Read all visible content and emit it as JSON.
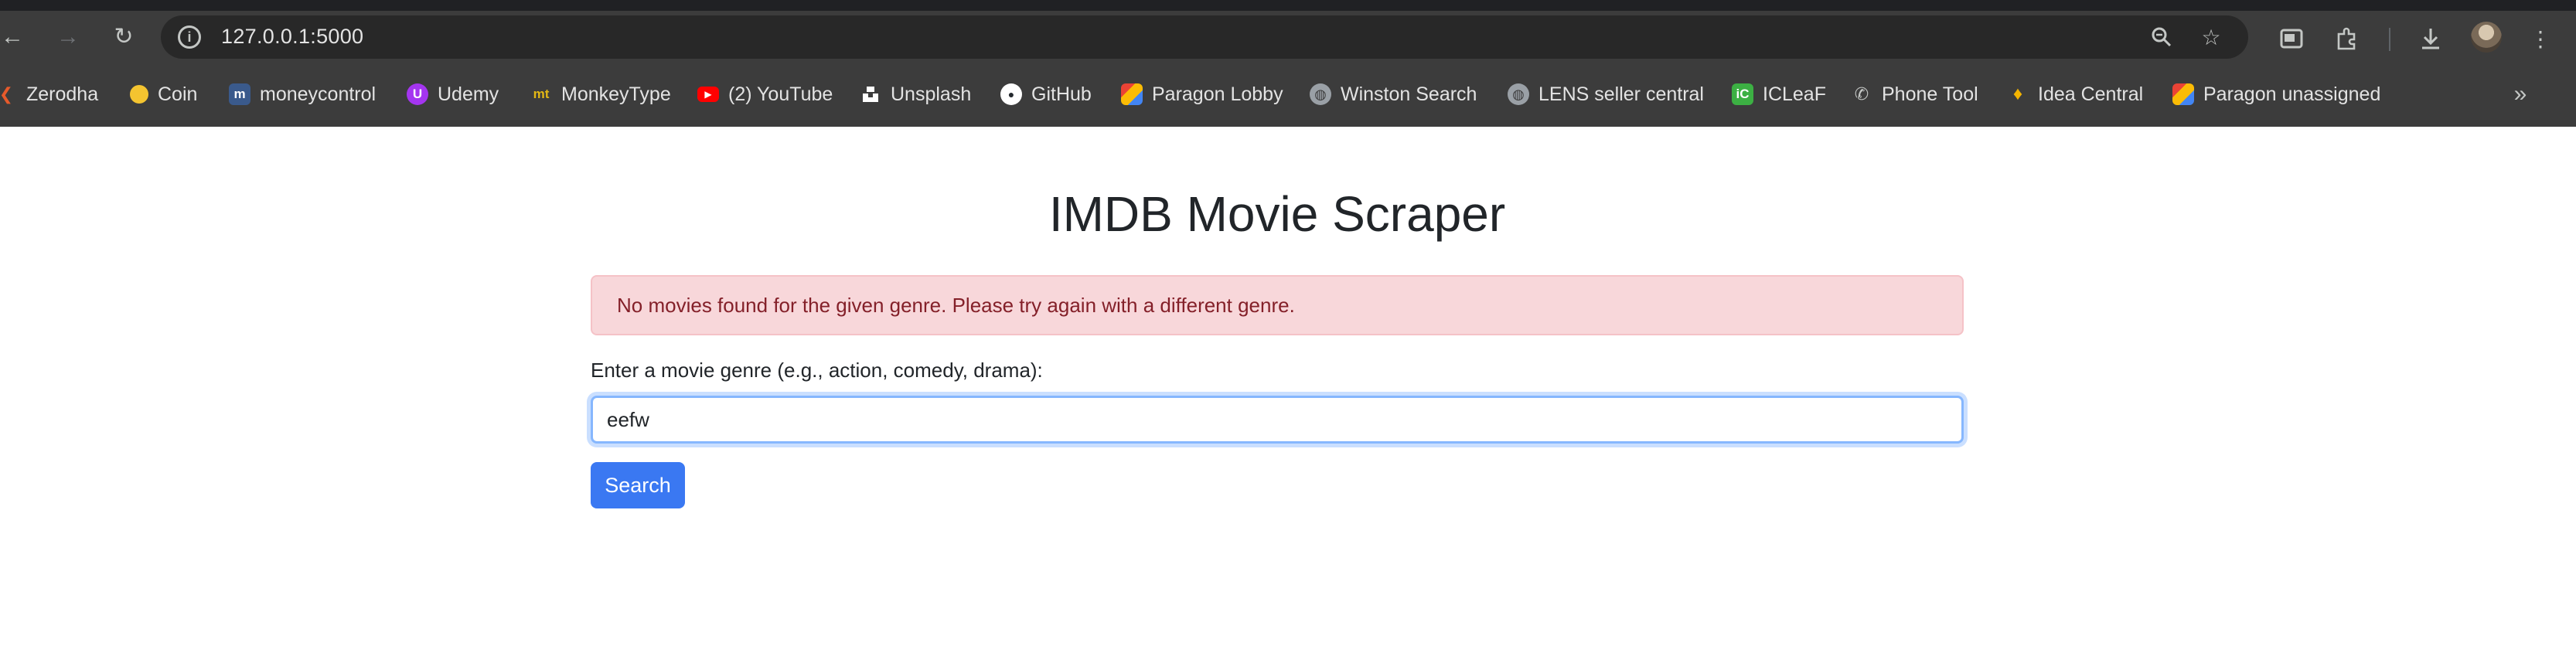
{
  "browser": {
    "url": "127.0.0.1:5000",
    "bookmarks": [
      {
        "label": "Zerodha",
        "icon": "zerodha-icon",
        "color": "#e65a2b"
      },
      {
        "label": "Coin",
        "icon": "coin-icon",
        "color": "#2a6ef5"
      },
      {
        "label": "moneycontrol",
        "icon": "moneycontrol-icon",
        "color": "#3a5a8c"
      },
      {
        "label": "Udemy",
        "icon": "udemy-icon",
        "color": "#a435f0"
      },
      {
        "label": "MonkeyType",
        "icon": "monkeytype-icon",
        "color": "#e2b714"
      },
      {
        "label": "(2) YouTube",
        "icon": "youtube-icon",
        "color": "#ff0000"
      },
      {
        "label": "Unsplash",
        "icon": "unsplash-icon",
        "color": "#ffffff"
      },
      {
        "label": "GitHub",
        "icon": "github-icon",
        "color": "#ffffff"
      },
      {
        "label": "Paragon Lobby",
        "icon": "paragon-icon",
        "color": "#4a8af4"
      },
      {
        "label": "Winston Search",
        "icon": "globe-icon",
        "color": "#c4c7c5"
      },
      {
        "label": "LENS seller central",
        "icon": "globe-icon",
        "color": "#c4c7c5"
      },
      {
        "label": "ICLeaF",
        "icon": "icleaf-icon",
        "color": "#3cb043"
      },
      {
        "label": "Phone Tool",
        "icon": "phone-icon",
        "color": "#c4c7c5"
      },
      {
        "label": "Idea Central",
        "icon": "idea-icon",
        "color": "#f4b400"
      },
      {
        "label": "Paragon unassigned",
        "icon": "paragon-icon",
        "color": "#4a8af4"
      }
    ]
  },
  "page": {
    "title": "IMDB Movie Scraper",
    "alert": "No movies found for the given genre. Please try again with a different genre.",
    "label": "Enter a movie genre (e.g., action, comedy, drama):",
    "input_value": "eefw",
    "button": "Search"
  },
  "colors": {
    "alert_bg": "#f8d7da",
    "alert_text": "#842029",
    "primary": "#3a78f2",
    "focus_border": "#86b7fe"
  }
}
